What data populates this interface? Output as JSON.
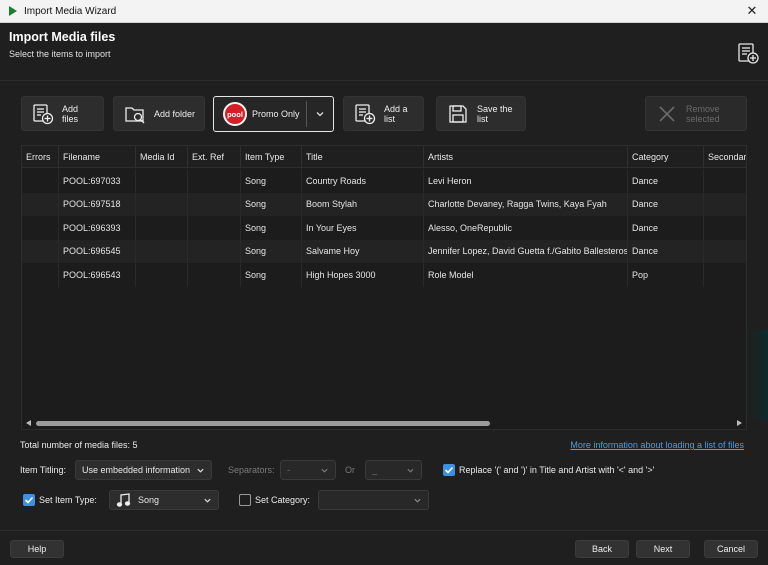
{
  "window": {
    "title": "Import Media Wizard"
  },
  "header": {
    "title": "Import Media files",
    "subtitle": "Select the items to import"
  },
  "toolbar": {
    "add_files": "Add files",
    "add_folder": "Add folder",
    "promo_logo": "pool",
    "promo_label": "Promo Only",
    "add_list": "Add a list",
    "save_list": "Save the list",
    "remove_selected": "Remove selected"
  },
  "grid": {
    "columns": [
      "Errors",
      "Filename",
      "Media Id",
      "Ext. Ref",
      "Item Type",
      "Title",
      "Artists",
      "Category",
      "Secondary"
    ],
    "rows": [
      {
        "errors": "",
        "filename": "POOL:697033",
        "media_id": "",
        "ext_ref": "",
        "item_type": "Song",
        "title": "Country Roads",
        "artists": "Levi Heron",
        "category": "Dance",
        "secondary": ""
      },
      {
        "errors": "",
        "filename": "POOL:697518",
        "media_id": "",
        "ext_ref": "",
        "item_type": "Song",
        "title": "Boom Stylah",
        "artists": "Charlotte Devaney, Ragga Twins, Kaya Fyah",
        "category": "Dance",
        "secondary": ""
      },
      {
        "errors": "",
        "filename": "POOL:696393",
        "media_id": "",
        "ext_ref": "",
        "item_type": "Song",
        "title": "In Your Eyes",
        "artists": "Alesso, OneRepublic",
        "category": "Dance",
        "secondary": ""
      },
      {
        "errors": "",
        "filename": "POOL:696545",
        "media_id": "",
        "ext_ref": "",
        "item_type": "Song",
        "title": "Salvame Hoy",
        "artists": "Jennifer Lopez, David Guetta f./Gabito Ballesteros",
        "category": "Dance",
        "secondary": ""
      },
      {
        "errors": "",
        "filename": "POOL:696543",
        "media_id": "",
        "ext_ref": "",
        "item_type": "Song",
        "title": "High Hopes 3000",
        "artists": "Role Model",
        "category": "Pop",
        "secondary": ""
      }
    ]
  },
  "status": {
    "total": "Total number of media files: 5",
    "more_link": "More information about loading a list of files"
  },
  "options": {
    "item_titling_label": "Item Titling:",
    "item_titling_value": "Use embedded information",
    "separators_label": "Separators:",
    "separator1_value": "-",
    "or_label": "Or",
    "separator2_value": "_",
    "replace_label": "Replace '(' and ')' in Title and Artist with '<' and '>'",
    "replace_checked": true,
    "set_item_type_label": "Set Item Type:",
    "set_item_type_checked": true,
    "item_type_value": "Song",
    "set_category_label": "Set Category:",
    "set_category_checked": false,
    "category_value": ""
  },
  "footer": {
    "help": "Help",
    "back": "Back",
    "next": "Next",
    "cancel": "Cancel"
  },
  "colors": {
    "accent": "#3d8fe0",
    "link": "#4a9fe6",
    "promo_red": "#d32027",
    "background": "#1f1f1f"
  },
  "icons": {
    "window": "play-icon",
    "header": "add-list-icon",
    "add_files": "add-file-icon",
    "add_folder": "folder-search-icon",
    "add_list": "add-list-icon",
    "save_list": "save-icon",
    "remove": "close-x-icon",
    "item_type": "music-note-icon"
  }
}
